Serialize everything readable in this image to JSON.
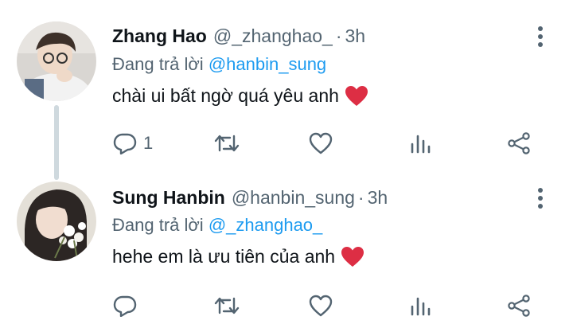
{
  "replies": [
    {
      "name": "Zhang Hao",
      "handle": "@_zhanghao_",
      "separator": "·",
      "time": "3h",
      "replying_prefix": "Đang trả lời",
      "replying_to": "@hanbin_sung",
      "text": "chài ui bất ngờ quá yêu anh",
      "reply_count": "1",
      "icons": [
        "reply-icon",
        "retweet-icon",
        "like-icon",
        "views-icon",
        "share-icon"
      ]
    },
    {
      "name": "Sung Hanbin",
      "handle": "@hanbin_sung",
      "separator": "·",
      "time": "3h",
      "replying_prefix": "Đang trả lời",
      "replying_to": "@_zhanghao_",
      "text": "hehe em là ưu tiên của anh",
      "reply_count": "",
      "icons": [
        "reply-icon",
        "retweet-icon",
        "like-icon",
        "views-icon",
        "share-icon"
      ]
    }
  ],
  "colors": {
    "text": "#0f1419",
    "secondary": "#536471",
    "link": "#1d9bf0",
    "emoji_heart": "#e0245e",
    "thread_line": "#cfd9de"
  }
}
